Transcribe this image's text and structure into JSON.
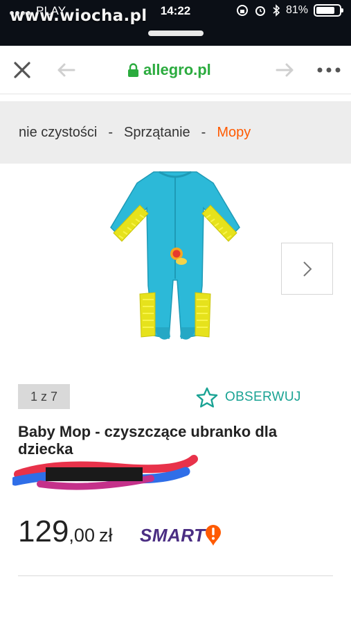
{
  "status_bar": {
    "carrier": "PLAY",
    "time": "14:22",
    "battery": "81%",
    "battery_level": 0.81,
    "watermark": "www.wiocha.pl",
    "icons": [
      "signal-dots-icon",
      "wifi-icon",
      "screen-lock-icon",
      "alarm-icon",
      "bluetooth-icon",
      "battery-icon"
    ]
  },
  "browser": {
    "url": "allegro.pl",
    "icons": [
      "close-icon",
      "back-arrow-icon",
      "lock-icon",
      "forward-arrow-icon",
      "more-icon"
    ],
    "colors": {
      "url": "#2bab3e",
      "lock": "#2bab3e"
    }
  },
  "breadcrumb": {
    "items": [
      "nie czystości",
      "Sprzątanie",
      "Mopy"
    ],
    "separator": "-",
    "colors": {
      "current": "#ff5a00",
      "background": "#ededed"
    }
  },
  "gallery": {
    "counter": "1 z 7",
    "image_icon": "baby-mop-onesie-image",
    "next_icon": "chevron-right-icon"
  },
  "watch": {
    "label": "OBSERWUJ",
    "icon": "star-outline-icon",
    "color": "#1aa394"
  },
  "product": {
    "title": "Baby Mop - czyszczące ubranko dla dziecka"
  },
  "price": {
    "integer": "129",
    "decimal": ",00",
    "currency": "zł"
  },
  "smart": {
    "label": "SMART",
    "icon": "smart-exclamation-icon",
    "colors": {
      "text": "#4b2e83",
      "badge": "#ff5a00"
    }
  }
}
